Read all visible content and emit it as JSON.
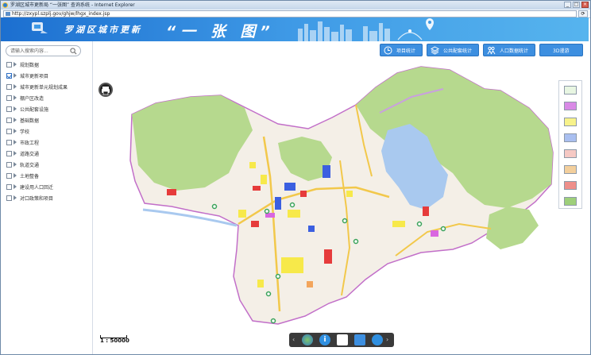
{
  "window": {
    "title": "罗湖区城市更新局 “一张图” 查询系统 - Internet Explorer",
    "url": "http://zxypl.szplj.gov/ghjw/lhgx_index.jsp"
  },
  "banner": {
    "site_title": "罗湖区城市更新",
    "slogan": "“一 张 图”"
  },
  "search": {
    "placeholder": "请输入搜索内容..."
  },
  "layers": [
    {
      "label": "规划数据",
      "checked": false
    },
    {
      "label": "城市更新项目",
      "checked": true
    },
    {
      "label": "城市更新单元规划成果",
      "checked": false
    },
    {
      "label": "棚户区改造",
      "checked": false
    },
    {
      "label": "公共配套设施",
      "checked": false
    },
    {
      "label": "基础数据",
      "checked": false
    },
    {
      "label": "学校",
      "checked": false
    },
    {
      "label": "市政工程",
      "checked": false
    },
    {
      "label": "道路交通",
      "checked": false
    },
    {
      "label": "轨道交通",
      "checked": false
    },
    {
      "label": "土地整备",
      "checked": false
    },
    {
      "label": "建设用人口回迁",
      "checked": false
    },
    {
      "label": "对口政策和项目",
      "checked": false
    }
  ],
  "toolbar": {
    "project_stats": "项目统计",
    "public_facility_stats": "公共配套统计",
    "population_stats": "人口数据统计",
    "view_3d": "3D漫游"
  },
  "legend_colors": [
    "#e8f6e2",
    "#d98ae6",
    "#f7f28a",
    "#a9bff0",
    "#f6c9c4",
    "#f3cf9c",
    "#ee8f8a",
    "#9ecf7a"
  ],
  "scale": "1 : 50000",
  "colors": {
    "banner": "#2f86dd",
    "button": "#3d8fe0",
    "green_land": "#b6d98e",
    "water": "#a9c9ef"
  }
}
